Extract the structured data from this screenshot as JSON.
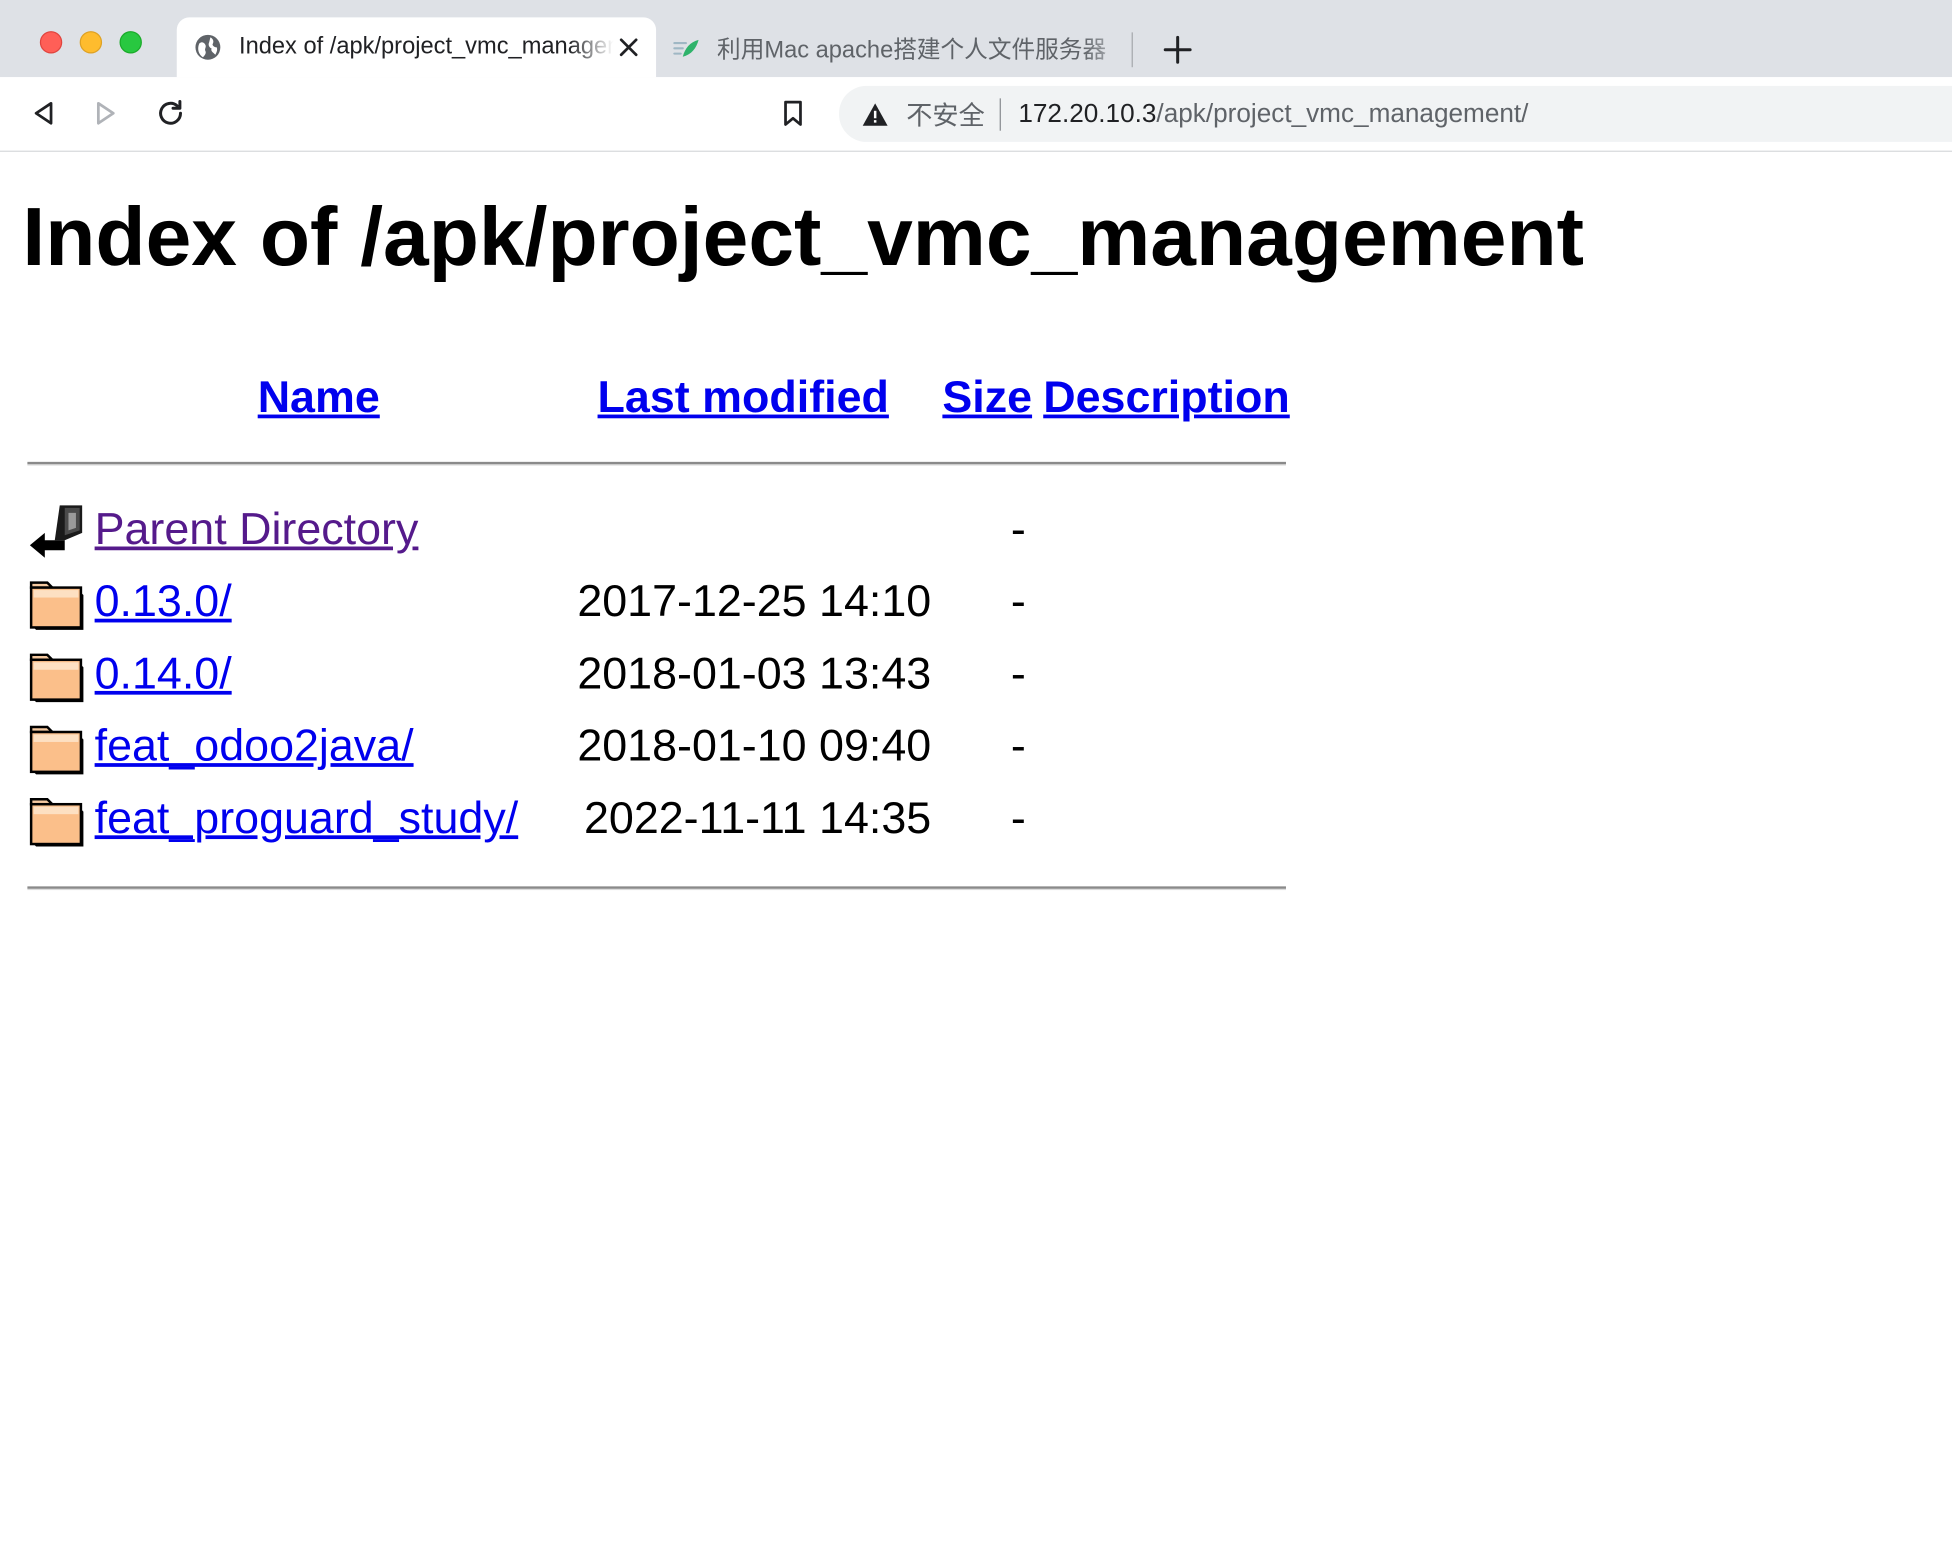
{
  "browser": {
    "tabs": [
      {
        "title": "Index of /apk/project_vmc_management",
        "active": true
      },
      {
        "title": "利用Mac apache搭建个人文件服务器",
        "active": false
      }
    ],
    "security_label": "不安全",
    "url_host": "172.20.10.3",
    "url_path": "/apk/project_vmc_management/"
  },
  "page": {
    "title": "Index of /apk/project_vmc_management",
    "columns": {
      "name": "Name",
      "last_modified": "Last modified",
      "size": "Size",
      "description": "Description"
    },
    "entries": [
      {
        "name": "Parent Directory",
        "modified": "",
        "size": "-",
        "description": "",
        "icon": "back-arrow-icon"
      },
      {
        "name": "0.13.0/",
        "modified": "2017-12-25 14:10",
        "size": "-",
        "description": "",
        "icon": "folder-icon"
      },
      {
        "name": "0.14.0/",
        "modified": "2018-01-03 13:43",
        "size": "-",
        "description": "",
        "icon": "folder-icon"
      },
      {
        "name": "feat_odoo2java/",
        "modified": "2018-01-10 09:40",
        "size": "-",
        "description": "",
        "icon": "folder-icon"
      },
      {
        "name": "feat_proguard_study/",
        "modified": "2022-11-11 14:35",
        "size": "-",
        "description": "",
        "icon": "folder-icon"
      }
    ]
  },
  "colors": {
    "link": "#0000ee",
    "visited_link": "#551a8b",
    "tabstrip": "#dee1e6",
    "omnibox": "#f1f3f4"
  }
}
